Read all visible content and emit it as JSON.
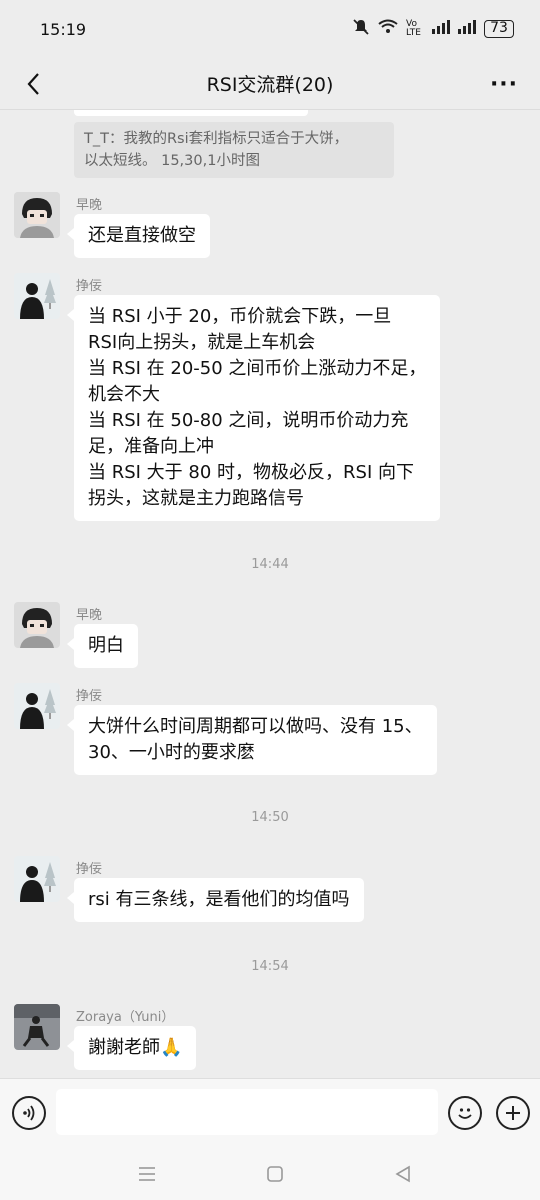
{
  "status_bar": {
    "time": "15:19",
    "network_label": "Vo LTE",
    "battery": "73"
  },
  "nav": {
    "title": "RSI交流群(20)",
    "more_label": "···"
  },
  "quote": {
    "line1": "T_T：我教的Rsi套利指标只适合于大饼，",
    "line2": "以太短线。 15,30,1小时图"
  },
  "messages": [
    {
      "sender": "早晚",
      "lines": [
        "还是直接做空"
      ]
    },
    {
      "sender": "挣佞",
      "lines": [
        "当 RSI 小于 20，币价就会下跌，一旦",
        "RSI向上拐头，就是上车机会",
        "当 RSI 在 20-50 之间币价上涨动力不足，",
        "机会不大",
        "当 RSI 在 50-80 之间，说明币价动力充",
        "足，准备向上冲",
        "当 RSI 大于 80 时，物极必反，RSI 向下",
        "拐头，这就是主力跑路信号"
      ]
    },
    {
      "timestamp": "14:44"
    },
    {
      "sender": "早晚",
      "lines": [
        "明白"
      ]
    },
    {
      "sender": "挣佞",
      "lines": [
        "大饼什么时间周期都可以做吗、没有 15、",
        "30、一小时的要求麽"
      ]
    },
    {
      "timestamp": "14:50"
    },
    {
      "sender": "挣佞",
      "lines": [
        "rsi 有三条线，是看他们的均值吗"
      ]
    },
    {
      "timestamp": "14:54"
    },
    {
      "sender": "Zoraya（Yuni）",
      "lines": [
        "謝謝老師🙏"
      ]
    }
  ],
  "input": {
    "value": "",
    "placeholder": ""
  },
  "icons": {
    "back": "chevron-left-icon",
    "more": "more-dots-icon",
    "voice": "voice-icon",
    "emoji": "emoji-icon",
    "add": "plus-icon",
    "menu": "menu-icon",
    "home": "home-icon",
    "back_nav": "back-triangle-icon"
  },
  "colors": {
    "background": "#ededed",
    "bubble": "#ffffff",
    "quote_bg": "#e2e2e2",
    "meta_text": "#8a8a8a"
  }
}
